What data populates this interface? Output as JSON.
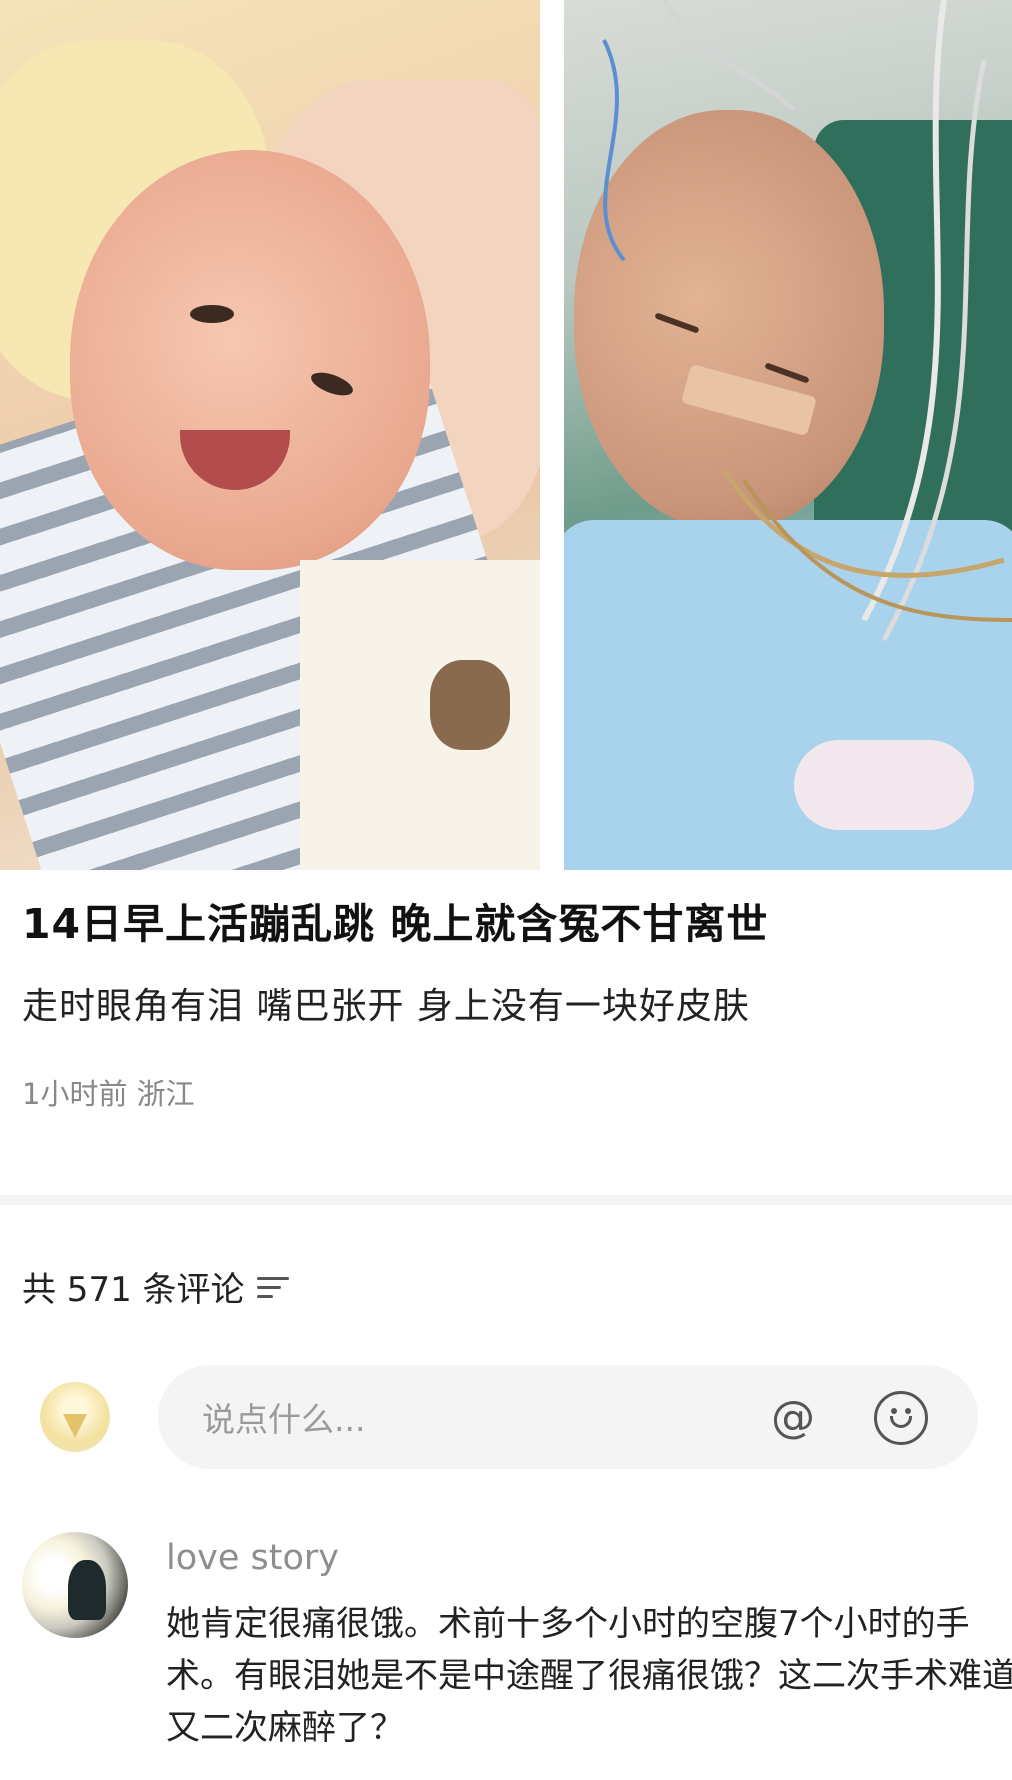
{
  "article": {
    "title": "14日早上活蹦乱跳 晚上就含冤不甘离世",
    "subtitle": "走时眼角有泪 嘴巴张开 身上没有一块好皮肤",
    "meta": "1小时前 浙江"
  },
  "comments_header": {
    "label": "共 571 条评论",
    "sort_icon": "sort-lines-icon"
  },
  "input": {
    "placeholder": "说点什么...",
    "at_icon": "@",
    "emoji_icon": "smile-icon"
  },
  "comments": [
    {
      "username": "love story",
      "text": "她肯定很痛很饿。术前十多个小时的空腹7个小时的手术。有眼泪她是不是中途醒了很痛很饿？这二次手术难道又二次麻醉了？"
    }
  ]
}
